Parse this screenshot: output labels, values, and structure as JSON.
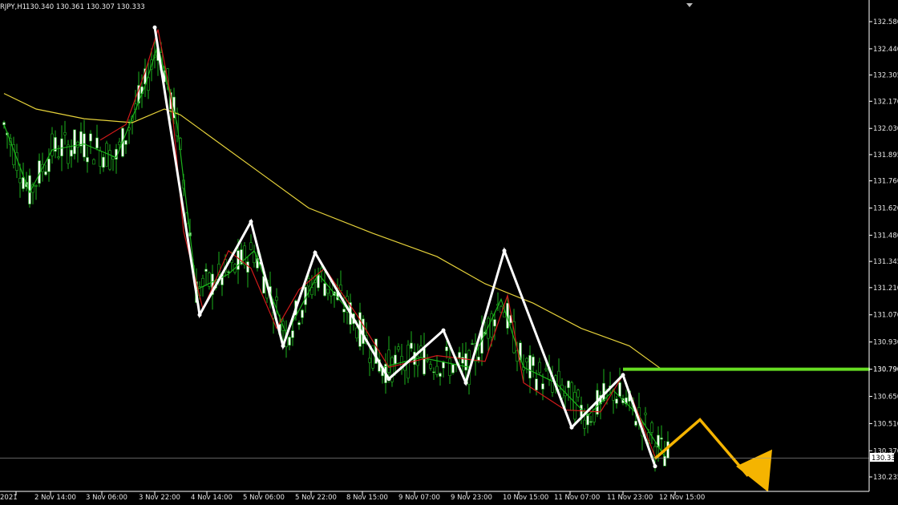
{
  "header": {
    "symbol_timeframe": "RJPY,H1",
    "ohlc": "130.340 130.361 130.307 130.333"
  },
  "colors": {
    "background": "#000000",
    "bull_candle": "#ffffff",
    "bear_candle": "#000000",
    "wick_outline": "#1db21d",
    "fast_ma": "#d11a1a",
    "slow_ma": "#1bb31b",
    "long_ma": "#e6d23a",
    "zigzag": "#ffffff",
    "resistance": "#66dd22",
    "projection": "#f5b400",
    "axis": "#ffffff"
  },
  "current_price_label": "130.333",
  "resistance_label": "130.790",
  "chart_data": {
    "type": "line",
    "title": "",
    "xlabel": "",
    "ylabel": "",
    "ylim": [
      130.16,
      132.68
    ],
    "y_ticks": [
      "132.580",
      "132.440",
      "132.305",
      "132.170",
      "132.030",
      "131.895",
      "131.760",
      "131.620",
      "131.480",
      "131.345",
      "131.210",
      "131.070",
      "130.930",
      "130.790",
      "130.650",
      "130.510",
      "130.370",
      "130.235"
    ],
    "x_ticks": [
      "2021",
      "2 Nov 14:00",
      "3 Nov 06:00",
      "3 Nov 22:00",
      "4 Nov 14:00",
      "5 Nov 06:00",
      "5 Nov 22:00",
      "8 Nov 15:00",
      "9 Nov 07:00",
      "9 Nov 23:00",
      "10 Nov 15:00",
      "11 Nov 07:00",
      "11 Nov 23:00",
      "12 Nov 15:00"
    ],
    "x_range": [
      0,
      270
    ],
    "series": [
      {
        "name": "",
        "role": "zigzag",
        "points": [
          [
            47,
            132.55
          ],
          [
            61,
            131.07
          ],
          [
            77,
            131.55
          ],
          [
            87,
            130.91
          ],
          [
            97,
            131.39
          ],
          [
            120,
            130.74
          ],
          [
            137,
            130.99
          ],
          [
            144,
            130.72
          ],
          [
            156,
            131.4
          ],
          [
            177,
            130.49
          ],
          [
            193,
            130.76
          ],
          [
            203,
            130.29
          ]
        ]
      },
      {
        "name": "",
        "role": "long_ma",
        "points": [
          [
            0,
            132.21
          ],
          [
            10,
            132.13
          ],
          [
            25,
            132.08
          ],
          [
            40,
            132.06
          ],
          [
            50,
            132.13
          ],
          [
            55,
            132.1
          ],
          [
            65,
            131.98
          ],
          [
            80,
            131.8
          ],
          [
            95,
            131.62
          ],
          [
            115,
            131.49
          ],
          [
            135,
            131.37
          ],
          [
            150,
            131.23
          ],
          [
            165,
            131.13
          ],
          [
            180,
            131.0
          ],
          [
            195,
            130.91
          ],
          [
            205,
            130.79
          ]
        ]
      },
      {
        "name": "",
        "role": "fast_ma",
        "points": [
          [
            30,
            131.97
          ],
          [
            38,
            132.05
          ],
          [
            44,
            132.32
          ],
          [
            48,
            132.54
          ],
          [
            52,
            132.2
          ],
          [
            56,
            131.5
          ],
          [
            62,
            131.1
          ],
          [
            70,
            131.4
          ],
          [
            77,
            131.31
          ],
          [
            85,
            131.0
          ],
          [
            92,
            131.2
          ],
          [
            100,
            131.31
          ],
          [
            110,
            131.07
          ],
          [
            120,
            130.8
          ],
          [
            135,
            130.86
          ],
          [
            150,
            130.83
          ],
          [
            157,
            131.17
          ],
          [
            162,
            130.72
          ],
          [
            175,
            130.58
          ],
          [
            186,
            130.57
          ],
          [
            193,
            130.76
          ],
          [
            203,
            130.34
          ]
        ]
      },
      {
        "name": "",
        "role": "slow_ma",
        "points": [
          [
            0,
            132.05
          ],
          [
            8,
            131.7
          ],
          [
            15,
            131.92
          ],
          [
            25,
            131.95
          ],
          [
            35,
            131.88
          ],
          [
            44,
            132.25
          ],
          [
            48,
            132.46
          ],
          [
            54,
            132.05
          ],
          [
            60,
            131.2
          ],
          [
            70,
            131.28
          ],
          [
            78,
            131.4
          ],
          [
            88,
            130.97
          ],
          [
            98,
            131.28
          ],
          [
            108,
            131.08
          ],
          [
            118,
            130.8
          ],
          [
            130,
            130.85
          ],
          [
            145,
            130.8
          ],
          [
            155,
            131.15
          ],
          [
            162,
            130.8
          ],
          [
            172,
            130.72
          ],
          [
            182,
            130.55
          ],
          [
            190,
            130.68
          ],
          [
            198,
            130.55
          ],
          [
            206,
            130.34
          ]
        ]
      },
      {
        "name": "",
        "role": "resistance",
        "points": [
          [
            193,
            130.79
          ],
          [
            270,
            130.79
          ]
        ]
      },
      {
        "name": "",
        "role": "projection",
        "points": [
          [
            203,
            130.33
          ],
          [
            217,
            130.53
          ],
          [
            232,
            130.24
          ]
        ]
      }
    ]
  }
}
